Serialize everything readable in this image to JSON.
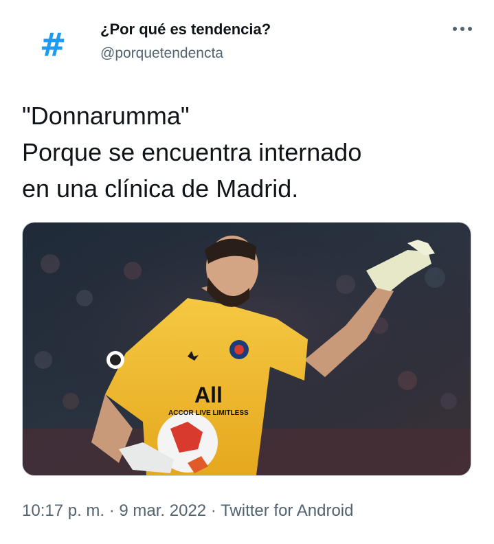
{
  "account": {
    "avatar_glyph": "#",
    "avatar_icon": "hashtag-icon",
    "display_name": "¿Por qué es tendencia?",
    "handle": "@porquetendencta"
  },
  "menu": {
    "icon": "more-dots-icon"
  },
  "tweet": {
    "text": "\"Donnarumma\"\nPorque se encuentra internado\nen una clínica de Madrid.",
    "image_jersey_text_1": "All",
    "image_jersey_text_2": "ACCOR LIVE LIMITLESS"
  },
  "meta": {
    "time": "10:17 p. m.",
    "separator": " · ",
    "date": "9 mar. 2022",
    "source": "Twitter for Android"
  },
  "colors": {
    "accent": "#1d9bf0",
    "text_primary": "#0f1419",
    "text_secondary": "#536471",
    "jersey": "#f2c233"
  }
}
